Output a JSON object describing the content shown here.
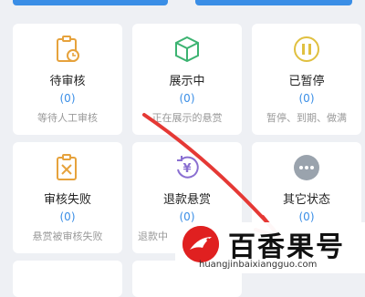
{
  "cards": [
    {
      "title": "待审核",
      "count": "(0)",
      "desc": "等待人工审核",
      "icon": "clipboard-clock-icon",
      "color": "#e6a23c"
    },
    {
      "title": "展示中",
      "count": "(0)",
      "desc": "正在展示的悬赏",
      "icon": "cube-icon",
      "color": "#3cb371"
    },
    {
      "title": "已暂停",
      "count": "(0)",
      "desc": "暂停、到期、做满",
      "icon": "pause-circle-icon",
      "color": "#e0c040"
    },
    {
      "title": "审核失败",
      "count": "(0)",
      "desc": "悬赏被审核失败",
      "icon": "clipboard-x-icon",
      "color": "#e6a23c"
    },
    {
      "title": "退款悬赏",
      "count": "(0)",
      "desc": "退款中",
      "icon": "yen-refund-icon",
      "color": "#8a6fd1"
    },
    {
      "title": "其它状态",
      "count": "(0)",
      "desc": "",
      "icon": "more-dots-icon",
      "color": "#9aa3ad"
    }
  ],
  "watermark": {
    "brand": "百香果号",
    "url": "huangjinbaixiangguo.com",
    "logo": "logo-icon"
  },
  "colors": {
    "accent": "#3a8ee6",
    "arrow": "#e53935"
  }
}
